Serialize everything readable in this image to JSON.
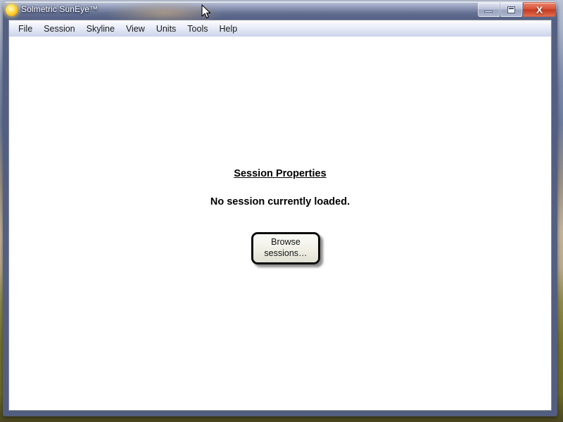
{
  "window": {
    "title": "Solmetric SunEye™",
    "app_icon": "sun-icon",
    "controls": {
      "minimize_label": "–",
      "maximize_label": "□",
      "close_label": "X"
    }
  },
  "menubar": {
    "items": [
      {
        "label": "File"
      },
      {
        "label": "Session"
      },
      {
        "label": "Skyline"
      },
      {
        "label": "View"
      },
      {
        "label": "Units"
      },
      {
        "label": "Tools"
      },
      {
        "label": "Help"
      }
    ]
  },
  "content": {
    "heading": "Session Properties",
    "message": "No session currently loaded.",
    "browse_button": {
      "line1": "Browse",
      "line2": "sessions…"
    }
  },
  "colors": {
    "close_button": "#c23a22",
    "client_background": "#ffffff",
    "menubar_gradient_top": "#fdfdff",
    "menubar_gradient_bottom": "#cbd4ea",
    "title_text": "#ffffff",
    "frame_bottom": "#4a4620"
  }
}
